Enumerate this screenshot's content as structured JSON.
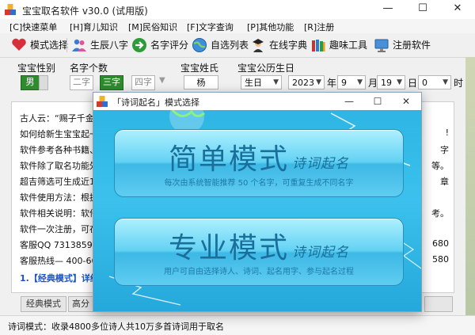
{
  "window": {
    "title": "宝宝取名软件 v30.0 (试用版)",
    "minimize": "—",
    "maximize": "☐",
    "close": "✕"
  },
  "menu": [
    "[C]快速菜单",
    "[H]育儿知识",
    "[M]民俗知识",
    "[F]文字查询",
    "[P]其他功能",
    "[R]注册"
  ],
  "toolbar": {
    "mode_select": "模式选择",
    "birth": "生辰八字",
    "score": "名字评分",
    "list": "自选列表",
    "dict": "在线字典",
    "fun": "趣味工具",
    "register": "注册软件"
  },
  "options": {
    "gender_label": "宝宝性别",
    "gender_value": "男",
    "count_label": "名字个数",
    "count_options": [
      "二字",
      "三字",
      "四字"
    ],
    "count_selected": "三字",
    "surname_label": "宝宝姓氏",
    "surname_value": "杨",
    "birth_label": "宝宝公历生日",
    "birth_type": "生日",
    "year": "2023",
    "year_unit": "年",
    "month": "9",
    "month_unit": "月",
    "day": "19",
    "day_unit": "日",
    "hour": "0",
    "hour_unit": "时"
  },
  "text_lines": [
    "古人云：“赐子千金",
    "如何给新生宝宝起一",
    "软件参考各种书籍、",
    "软件除了取名功能外",
    "超吉筛选可生成近10",
    "软件使用方法：根据",
    "软件相关说明：软件",
    "软件一次注册，可在",
    "客服QQ  731385908",
    "客服热线— 400-666"
  ],
  "right_fragments": [
    "",
    "!",
    "字",
    "等。",
    "章",
    "",
    "考。",
    "",
    "680",
    "580"
  ],
  "link_text": "1.【经典模式】详细",
  "bottom_buttons": [
    "经典模式",
    "高分"
  ],
  "status": "诗词模式：收录4800多位诗人共10万多首诗词用于取名",
  "dialog": {
    "title": "「诗词起名」模式选择",
    "minimize": "—",
    "maximize": "☐",
    "close": "✕",
    "simple_title": "简单模式",
    "simple_sub": "诗词起名",
    "simple_desc": "每次由系统智能推荐 50 个名字，可重复生成不同名字",
    "pro_title": "专业模式",
    "pro_sub": "诗词起名",
    "pro_desc": "用户可自由选择诗人、诗词、起名用字、参与起名过程"
  },
  "colors": {
    "accent_green": "#2e8b2e",
    "dialog_blue": "#2fb5e3",
    "link_blue": "#1a55c0"
  }
}
